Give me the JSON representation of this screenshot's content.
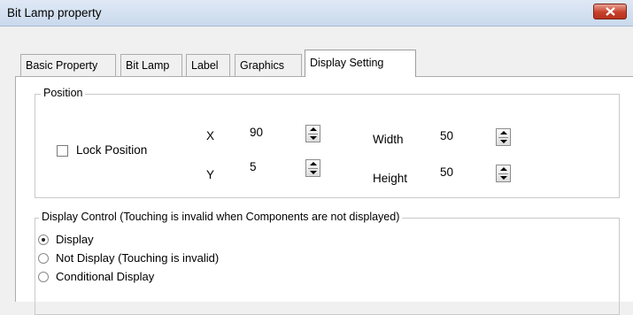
{
  "window": {
    "title": "Bit Lamp property"
  },
  "tabs": [
    {
      "label": "Basic Property"
    },
    {
      "label": "Bit Lamp"
    },
    {
      "label": "Label"
    },
    {
      "label": "Graphics"
    },
    {
      "label": "Display Setting",
      "active": true
    }
  ],
  "position_group": {
    "legend": "Position",
    "lock_position": {
      "label": "Lock Position",
      "checked": false
    },
    "x": {
      "label": "X",
      "value": "90"
    },
    "y": {
      "label": "Y",
      "value": "5"
    },
    "width": {
      "label": "Width",
      "value": "50"
    },
    "height": {
      "label": "Height",
      "value": "50"
    }
  },
  "display_control": {
    "legend": "Display Control (Touching is invalid when Components are not displayed)",
    "options": [
      {
        "label": "Display",
        "selected": true
      },
      {
        "label": "Not Display (Touching is invalid)",
        "selected": false
      },
      {
        "label": "Conditional Display",
        "selected": false
      }
    ]
  },
  "colors": {
    "close_button": "#c7402a",
    "titlebar": "#dfe9f5",
    "panel": "#ffffff"
  }
}
